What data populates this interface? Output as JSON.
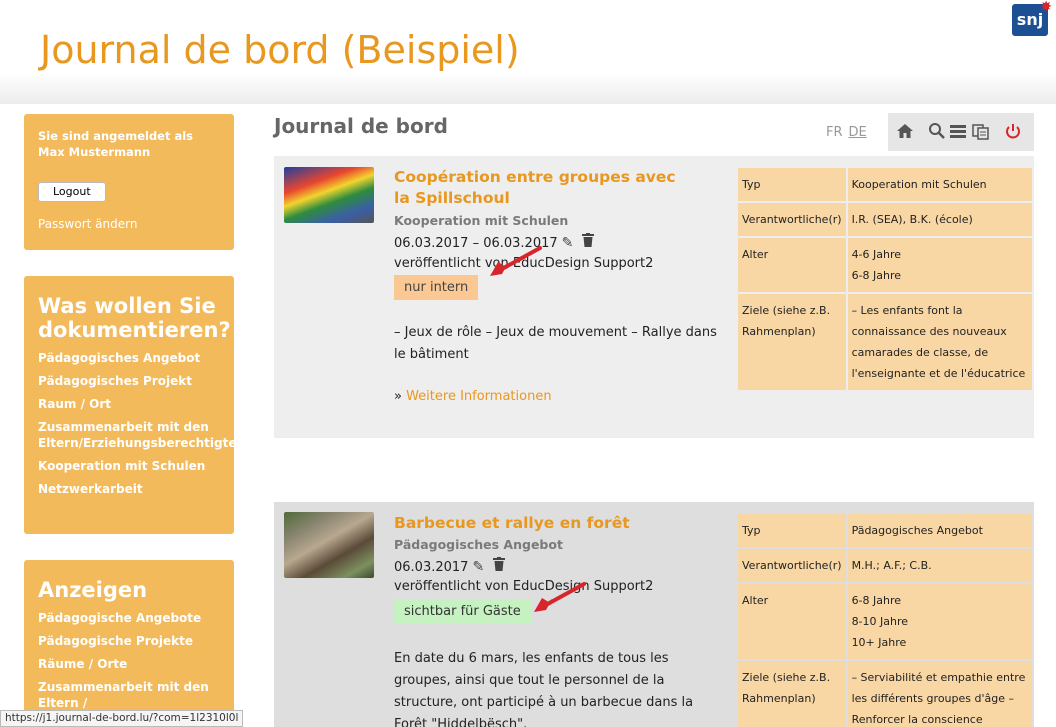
{
  "header": {
    "title": "Journal de bord (Beispiel)",
    "logo_text": "snj"
  },
  "login_box": {
    "logged_in_text": "Sie sind angemeldet als Max Mustermann",
    "logout_label": "Logout",
    "password_link": "Passwort ändern"
  },
  "doc_box": {
    "heading": "Was wollen Sie dokumentieren?",
    "items": [
      "Pädagogisches Angebot",
      "Pädagogisches Projekt",
      "Raum / Ort",
      "Zusammenarbeit mit den Eltern/Erziehungsberechtigten",
      "Kooperation mit Schulen",
      "Netzwerkarbeit"
    ]
  },
  "show_box": {
    "heading": "Anzeigen",
    "items": [
      "Pädagogische Angebote",
      "Pädagogische Projekte",
      "Räume / Orte",
      "Zusammenarbeit mit den Eltern /"
    ]
  },
  "main": {
    "title": "Journal de bord",
    "lang_fr": "FR",
    "lang_de": "DE",
    "toolbar_icons": [
      "home-icon",
      "search-icon",
      "list-icon",
      "copy-icon",
      "power-icon"
    ]
  },
  "entries": [
    {
      "title": "Coopération entre groupes avec la Spillschoul",
      "category": "Kooperation mit Schulen",
      "date": "06.03.2017 – 06.03.2017",
      "published": "veröffentlicht von EducDesign Support2",
      "badge": "nur intern",
      "description": "– Jeux de rôle – Jeux de mouvement – Rallye dans le bâtiment",
      "more_prefix": "» ",
      "more_label": "Weitere Informationen",
      "meta": [
        {
          "key": "Typ",
          "values": [
            "Kooperation mit Schulen"
          ]
        },
        {
          "key": "Verantwortliche(r)",
          "values": [
            "I.R. (SEA), B.K. (école)"
          ]
        },
        {
          "key": "Alter",
          "values": [
            "4-6 Jahre",
            "6-8 Jahre"
          ]
        },
        {
          "key": "Ziele (siehe z.B. Rahmenplan)",
          "values": [
            "– Les enfants font la connaissance des nouveaux camarades de classe, de l'enseignante et de l'éducatrice"
          ]
        }
      ]
    },
    {
      "title": "Barbecue et rallye en forêt",
      "category": "Pädagogisches Angebot",
      "date": "06.03.2017",
      "published": "veröffentlicht von EducDesign Support2",
      "badge": "sichtbar für Gäste",
      "description": "En date du 6 mars, les enfants de tous les groupes, ainsi que tout le personnel de la structure, ont participé à un barbecue dans la Forêt \"Hiddelbësch\".",
      "meta": [
        {
          "key": "Typ",
          "values": [
            "Pädagogisches Angebot"
          ]
        },
        {
          "key": "Verantwortliche(r)",
          "values": [
            "M.H.; A.F.; C.B."
          ]
        },
        {
          "key": "Alter",
          "values": [
            "6-8 Jahre",
            "8-10 Jahre",
            "10+ Jahre"
          ]
        },
        {
          "key": "Ziele (siehe z.B. Rahmenplan)",
          "values": [
            "– Serviabilité et empathie entre les différents groupes d'âge – Renforcer la conscience"
          ]
        }
      ]
    }
  ],
  "statusbar": {
    "url": "https://j1.journal-de-bord.lu/?com=1l2310l0l"
  },
  "colors": {
    "accent": "#e8971f",
    "sidebar": "#f3ba5c",
    "badge_intern": "#fbc893",
    "badge_guest": "#c6f2c2",
    "meta_cell": "#f9d7a5"
  }
}
